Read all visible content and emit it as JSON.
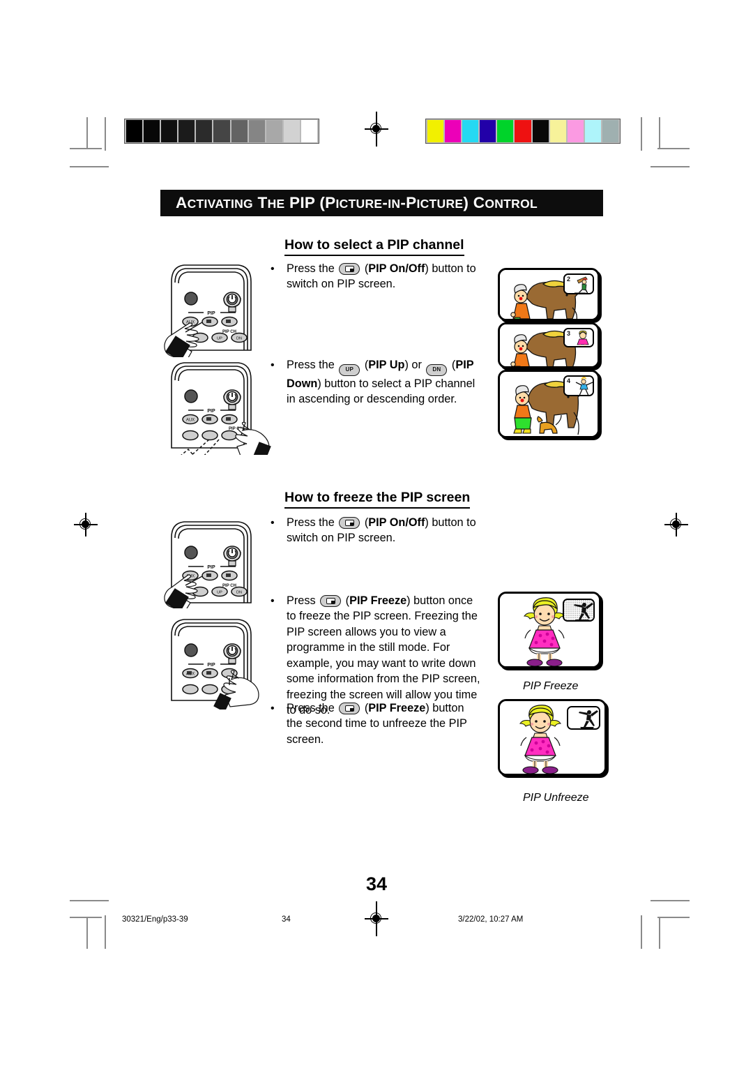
{
  "document": {
    "chapter_title_parts": [
      {
        "text": "A",
        "caps": true
      },
      {
        "text": "CTIVATING",
        "caps": false
      },
      {
        "text": " ",
        "caps": true
      },
      {
        "text": "T",
        "caps": true
      },
      {
        "text": "HE",
        "caps": false
      },
      {
        "text": " PIP (",
        "caps": true
      },
      {
        "text": "P",
        "caps": true
      },
      {
        "text": "ICTURE",
        "caps": false
      },
      {
        "text": "-",
        "caps": true
      },
      {
        "text": "IN",
        "caps": false
      },
      {
        "text": "-",
        "caps": true
      },
      {
        "text": "P",
        "caps": true
      },
      {
        "text": "ICTURE",
        "caps": false
      },
      {
        "text": ") ",
        "caps": true
      },
      {
        "text": "C",
        "caps": true
      },
      {
        "text": "ONTROL",
        "caps": false
      }
    ],
    "chapter_title_plain": "ACTIVATING THE PIP (PICTURE-IN-PICTURE) CONTROL",
    "page_number": "34"
  },
  "sections": [
    {
      "heading": "How to select a PIP channel",
      "bullets": [
        {
          "parts": [
            {
              "t": "Press the ",
              "style": "normal"
            },
            {
              "t": "",
              "style": "key-pip"
            },
            {
              "t": " (",
              "style": "normal"
            },
            {
              "t": "PIP On/Off",
              "style": "bold"
            },
            {
              "t": ") button to switch on PIP screen.",
              "style": "normal"
            }
          ],
          "plain": "Press the (PIP On/Off) button to switch on PIP screen."
        },
        {
          "parts": [
            {
              "t": "Press the ",
              "style": "normal"
            },
            {
              "t": "UP",
              "style": "key-label"
            },
            {
              "t": " (",
              "style": "normal"
            },
            {
              "t": "PIP Up",
              "style": "bold"
            },
            {
              "t": ") or ",
              "style": "normal"
            },
            {
              "t": "DN",
              "style": "key-label"
            },
            {
              "t": " (",
              "style": "normal"
            },
            {
              "t": "PIP Down",
              "style": "bold"
            },
            {
              "t": ") button to select a PIP channel in ascending or descending order.",
              "style": "normal"
            }
          ],
          "plain": "Press the UP (PIP Up) or DN (PIP Down) button to select a PIP channel in ascending or descending order."
        }
      ]
    },
    {
      "heading": "How to freeze the PIP screen",
      "bullets": [
        {
          "parts": [
            {
              "t": "Press the ",
              "style": "normal"
            },
            {
              "t": "",
              "style": "key-pip"
            },
            {
              "t": " (",
              "style": "normal"
            },
            {
              "t": "PIP On/Off",
              "style": "bold"
            },
            {
              "t": ") button to switch on PIP screen.",
              "style": "normal"
            }
          ],
          "plain": "Press the (PIP On/Off) button to switch on PIP screen."
        },
        {
          "parts": [
            {
              "t": "Press ",
              "style": "normal"
            },
            {
              "t": "",
              "style": "key-pip"
            },
            {
              "t": " (",
              "style": "normal"
            },
            {
              "t": "PIP Freeze",
              "style": "bold"
            },
            {
              "t": ") button once to freeze the PIP screen. Freezing the PIP screen allows you to view a programme in the still mode. For example, you may want to write down some information from the PIP screen, freezing the screen will allow you time to do so.",
              "style": "normal"
            }
          ],
          "plain": "Press (PIP Freeze) button once to freeze the PIP screen. Freezing the PIP screen allows you to view a programme in the still mode. For example, you may want to write down some information from the PIP screen, freezing the screen will allow you time to do so."
        },
        {
          "parts": [
            {
              "t": "Press the ",
              "style": "normal"
            },
            {
              "t": "",
              "style": "key-pip"
            },
            {
              "t": " (",
              "style": "normal"
            },
            {
              "t": "PIP Freeze",
              "style": "bold"
            },
            {
              "t": ") button the second time to unfreeze the PIP screen.",
              "style": "normal"
            }
          ],
          "plain": "Press the (PIP Freeze) button the second time to unfreeze the PIP screen."
        }
      ]
    }
  ],
  "remote": {
    "pip_group_label": "PIP",
    "pip_ch_group_label": "PIP CH",
    "aux_label": "AUX",
    "up_label": "UP",
    "dn_label": "DN"
  },
  "tv_figures": {
    "channel_series": [
      {
        "pip_channel": "2",
        "pip_content": "baseball-batter"
      },
      {
        "pip_channel": "3",
        "pip_content": "girl-pink-dress"
      },
      {
        "pip_channel": "4",
        "pip_content": "dancer"
      }
    ],
    "freeze": {
      "caption": "PIP Freeze",
      "main_content": "girl-pink-dress",
      "pip_content": "dancer-silhouette-frozen"
    },
    "unfreeze": {
      "caption": "PIP Unfreeze",
      "main_content": "girl-pink-dress",
      "pip_content": "dancer-silhouette"
    }
  },
  "print_marks": {
    "grayscale_steps": [
      "#000000",
      "#070707",
      "#0f0f0f",
      "#1b1b1b",
      "#2b2b2b",
      "#454545",
      "#636363",
      "#858585",
      "#a8a8a8",
      "#d2d2d2",
      "#ffffff"
    ],
    "color_swatches": [
      "#f2f000",
      "#ec00b8",
      "#25d9f2",
      "#2200a8",
      "#00d32a",
      "#ee1111",
      "#080808",
      "#f7f29a",
      "#fb9ae2",
      "#aef4fa",
      "#9fb0b0"
    ]
  },
  "footer": {
    "file_ref": "30321/Eng/p33-39",
    "page": "34",
    "timestamp": "3/22/02, 10:27 AM"
  }
}
